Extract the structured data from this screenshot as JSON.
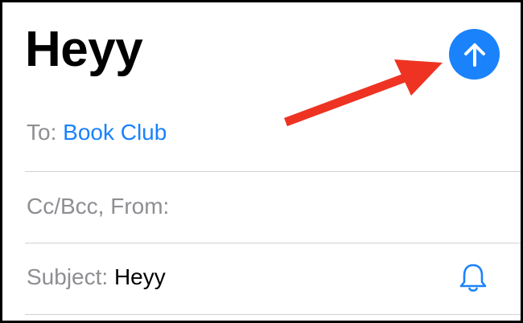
{
  "compose": {
    "title": "Heyy",
    "to_label": "To:",
    "to_value": "Book Club",
    "cc_label": "Cc/Bcc, From:",
    "subject_label": "Subject:",
    "subject_value": "Heyy"
  },
  "icons": {
    "send": "arrow-up-circle-icon",
    "notify": "bell-icon",
    "annotation": "red-pointer-arrow"
  },
  "colors": {
    "accent": "#1a82fb",
    "annotation": "#ee3323",
    "label_gray": "#8e8e93",
    "divider": "#d1d1d6"
  }
}
